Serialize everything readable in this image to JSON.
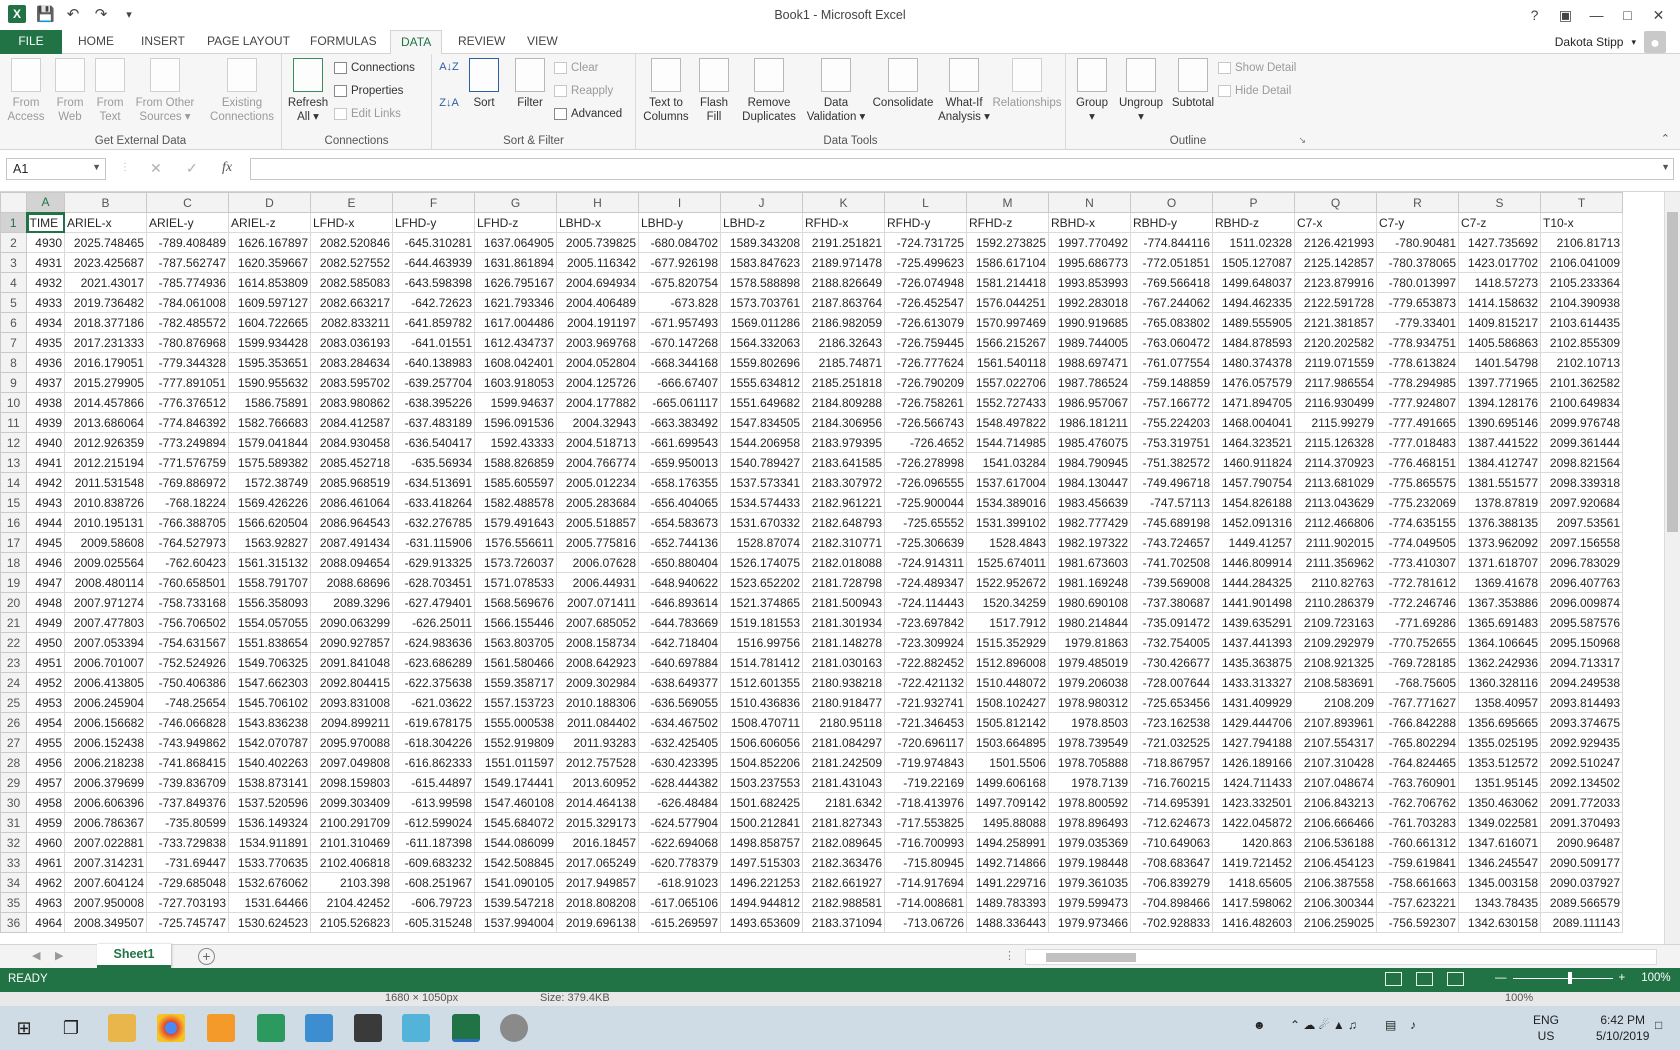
{
  "window": {
    "title": "Book1 - Microsoft Excel"
  },
  "user": {
    "name": "Dakota Stipp"
  },
  "tabs": [
    "FILE",
    "HOME",
    "INSERT",
    "PAGE LAYOUT",
    "FORMULAS",
    "DATA",
    "REVIEW",
    "VIEW"
  ],
  "ribbon": {
    "get_external": {
      "label": "Get External Data",
      "from_access": "From Access",
      "from_web": "From Web",
      "from_text": "From Text",
      "from_other": "From Other Sources",
      "existing": "Existing Connections"
    },
    "connections": {
      "label": "Connections",
      "refresh": "Refresh All",
      "connections": "Connections",
      "properties": "Properties",
      "edit_links": "Edit Links"
    },
    "sort_filter": {
      "label": "Sort & Filter",
      "sort": "Sort",
      "filter": "Filter",
      "clear": "Clear",
      "reapply": "Reapply",
      "advanced": "Advanced"
    },
    "data_tools": {
      "label": "Data Tools",
      "text_to_columns": "Text to Columns",
      "flash_fill": "Flash Fill",
      "remove_duplicates": "Remove Duplicates",
      "data_validation": "Data Validation",
      "consolidate": "Consolidate",
      "what_if": "What-If Analysis",
      "relationships": "Relationships"
    },
    "outline": {
      "label": "Outline",
      "group": "Group",
      "ungroup": "Ungroup",
      "subtotal": "Subtotal",
      "show_detail": "Show Detail",
      "hide_detail": "Hide Detail"
    }
  },
  "formula_bar": {
    "name_box": "A1",
    "fx": "fx",
    "value": ""
  },
  "grid": {
    "columns": [
      "A",
      "B",
      "C",
      "D",
      "E",
      "F",
      "G",
      "H",
      "I",
      "J",
      "K",
      "L",
      "M",
      "N",
      "O",
      "P",
      "Q",
      "R",
      "S",
      "T"
    ],
    "header_row": [
      "TIME",
      "ARIEL-x",
      "ARIEL-y",
      "ARIEL-z",
      "LFHD-x",
      "LFHD-y",
      "LFHD-z",
      "LBHD-x",
      "LBHD-y",
      "LBHD-z",
      "RFHD-x",
      "RFHD-y",
      "RFHD-z",
      "RBHD-x",
      "RBHD-y",
      "RBHD-z",
      "C7-x",
      "C7-y",
      "C7-z",
      "T10-x"
    ],
    "rows": [
      [
        "4930",
        "2025.748465",
        "-789.408489",
        "1626.167897",
        "2082.520846",
        "-645.310281",
        "1637.064905",
        "2005.739825",
        "-680.084702",
        "1589.343208",
        "2191.251821",
        "-724.731725",
        "1592.273825",
        "1997.770492",
        "-774.844116",
        "1511.02328",
        "2126.421993",
        "-780.90481",
        "1427.735692",
        "2106.81713"
      ],
      [
        "4931",
        "2023.425687",
        "-787.562747",
        "1620.359667",
        "2082.527552",
        "-644.463939",
        "1631.861894",
        "2005.116342",
        "-677.926198",
        "1583.847623",
        "2189.971478",
        "-725.499623",
        "1586.617104",
        "1995.686773",
        "-772.051851",
        "1505.127087",
        "2125.142857",
        "-780.378065",
        "1423.017702",
        "2106.041009"
      ],
      [
        "4932",
        "2021.43017",
        "-785.774936",
        "1614.853809",
        "2082.585083",
        "-643.598398",
        "1626.795167",
        "2004.694934",
        "-675.820754",
        "1578.588898",
        "2188.826649",
        "-726.074948",
        "1581.214418",
        "1993.853993",
        "-769.566418",
        "1499.648037",
        "2123.879916",
        "-780.013997",
        "1418.57273",
        "2105.233364"
      ],
      [
        "4933",
        "2019.736482",
        "-784.061008",
        "1609.597127",
        "2082.663217",
        "-642.72623",
        "1621.793346",
        "2004.406489",
        "-673.828",
        "1573.703761",
        "2187.863764",
        "-726.452547",
        "1576.044251",
        "1992.283018",
        "-767.244062",
        "1494.462335",
        "2122.591728",
        "-779.653873",
        "1414.158632",
        "2104.390938"
      ],
      [
        "4934",
        "2018.377186",
        "-782.485572",
        "1604.722665",
        "2082.833211",
        "-641.859782",
        "1617.004486",
        "2004.191197",
        "-671.957493",
        "1569.011286",
        "2186.982059",
        "-726.613079",
        "1570.997469",
        "1990.919685",
        "-765.083802",
        "1489.555905",
        "2121.381857",
        "-779.33401",
        "1409.815217",
        "2103.614435"
      ],
      [
        "4935",
        "2017.231333",
        "-780.876968",
        "1599.934428",
        "2083.036193",
        "-641.01551",
        "1612.434737",
        "2003.969768",
        "-670.147268",
        "1564.332063",
        "2186.32643",
        "-726.759445",
        "1566.215267",
        "1989.744005",
        "-763.060472",
        "1484.878593",
        "2120.202582",
        "-778.934751",
        "1405.586863",
        "2102.855309"
      ],
      [
        "4936",
        "2016.179051",
        "-779.344328",
        "1595.353651",
        "2083.284634",
        "-640.138983",
        "1608.042401",
        "2004.052804",
        "-668.344168",
        "1559.802696",
        "2185.74871",
        "-726.777624",
        "1561.540118",
        "1988.697471",
        "-761.077554",
        "1480.374378",
        "2119.071559",
        "-778.613824",
        "1401.54798",
        "2102.10713"
      ],
      [
        "4937",
        "2015.279905",
        "-777.891051",
        "1590.955632",
        "2083.595702",
        "-639.257704",
        "1603.918053",
        "2004.125726",
        "-666.67407",
        "1555.634812",
        "2185.251818",
        "-726.790209",
        "1557.022706",
        "1987.786524",
        "-759.148859",
        "1476.057579",
        "2117.986554",
        "-778.294985",
        "1397.771965",
        "2101.362582"
      ],
      [
        "4938",
        "2014.457866",
        "-776.376512",
        "1586.75891",
        "2083.980862",
        "-638.395226",
        "1599.94637",
        "2004.177882",
        "-665.061117",
        "1551.649682",
        "2184.809288",
        "-726.758261",
        "1552.727433",
        "1986.957067",
        "-757.166772",
        "1471.894705",
        "2116.930499",
        "-777.924807",
        "1394.128176",
        "2100.649834"
      ],
      [
        "4939",
        "2013.686064",
        "-774.846392",
        "1582.766683",
        "2084.412587",
        "-637.483189",
        "1596.091536",
        "2004.32943",
        "-663.383492",
        "1547.834505",
        "2184.306956",
        "-726.566743",
        "1548.497822",
        "1986.181211",
        "-755.224203",
        "1468.004041",
        "2115.99279",
        "-777.491665",
        "1390.695146",
        "2099.976748"
      ],
      [
        "4940",
        "2012.926359",
        "-773.249894",
        "1579.041844",
        "2084.930458",
        "-636.540417",
        "1592.43333",
        "2004.518713",
        "-661.699543",
        "1544.206958",
        "2183.979395",
        "-726.4652",
        "1544.714985",
        "1985.476075",
        "-753.319751",
        "1464.323521",
        "2115.126328",
        "-777.018483",
        "1387.441522",
        "2099.361444"
      ],
      [
        "4941",
        "2012.215194",
        "-771.576759",
        "1575.589382",
        "2085.452718",
        "-635.56934",
        "1588.826859",
        "2004.766774",
        "-659.950013",
        "1540.789427",
        "2183.641585",
        "-726.278998",
        "1541.03284",
        "1984.790945",
        "-751.382572",
        "1460.911824",
        "2114.370923",
        "-776.468151",
        "1384.412747",
        "2098.821564"
      ],
      [
        "4942",
        "2011.531548",
        "-769.886972",
        "1572.38749",
        "2085.968519",
        "-634.513691",
        "1585.605597",
        "2005.012234",
        "-658.176355",
        "1537.573341",
        "2183.307972",
        "-726.096555",
        "1537.617004",
        "1984.130447",
        "-749.496718",
        "1457.790754",
        "2113.681029",
        "-775.865575",
        "1381.551577",
        "2098.339318"
      ],
      [
        "4943",
        "2010.838726",
        "-768.18224",
        "1569.426226",
        "2086.461064",
        "-633.418264",
        "1582.488578",
        "2005.283684",
        "-656.404065",
        "1534.574433",
        "2182.961221",
        "-725.900044",
        "1534.389016",
        "1983.456639",
        "-747.57113",
        "1454.826188",
        "2113.043629",
        "-775.232069",
        "1378.87819",
        "2097.920684"
      ],
      [
        "4944",
        "2010.195131",
        "-766.388705",
        "1566.620504",
        "2086.964543",
        "-632.276785",
        "1579.491643",
        "2005.518857",
        "-654.583673",
        "1531.670332",
        "2182.648793",
        "-725.65552",
        "1531.399102",
        "1982.777429",
        "-745.689198",
        "1452.091316",
        "2112.466806",
        "-774.635155",
        "1376.388135",
        "2097.53561"
      ],
      [
        "4945",
        "2009.58608",
        "-764.527973",
        "1563.92827",
        "2087.491434",
        "-631.115906",
        "1576.556611",
        "2005.775816",
        "-652.744136",
        "1528.87074",
        "2182.310771",
        "-725.306639",
        "1528.4843",
        "1982.197322",
        "-743.724657",
        "1449.41257",
        "2111.902015",
        "-774.049505",
        "1373.962092",
        "2097.156558"
      ],
      [
        "4946",
        "2009.025564",
        "-762.60423",
        "1561.315132",
        "2088.094654",
        "-629.913325",
        "1573.726037",
        "2006.07628",
        "-650.880404",
        "1526.174075",
        "2182.018088",
        "-724.914311",
        "1525.674011",
        "1981.673603",
        "-741.702508",
        "1446.809914",
        "2111.356962",
        "-773.410307",
        "1371.618707",
        "2096.783029"
      ],
      [
        "4947",
        "2008.480114",
        "-760.658501",
        "1558.791707",
        "2088.68696",
        "-628.703451",
        "1571.078533",
        "2006.44931",
        "-648.940622",
        "1523.652202",
        "2181.728798",
        "-724.489347",
        "1522.952672",
        "1981.169248",
        "-739.569008",
        "1444.284325",
        "2110.82763",
        "-772.781612",
        "1369.41678",
        "2096.407763"
      ],
      [
        "4948",
        "2007.971274",
        "-758.733168",
        "1556.358093",
        "2089.3296",
        "-627.479401",
        "1568.569676",
        "2007.071411",
        "-646.893614",
        "1521.374865",
        "2181.500943",
        "-724.114443",
        "1520.34259",
        "1980.690108",
        "-737.380687",
        "1441.901498",
        "2110.286379",
        "-772.246746",
        "1367.353886",
        "2096.009874"
      ],
      [
        "4949",
        "2007.477803",
        "-756.706502",
        "1554.057055",
        "2090.063299",
        "-626.25011",
        "1566.155446",
        "2007.685052",
        "-644.783669",
        "1519.181553",
        "2181.301934",
        "-723.697842",
        "1517.7912",
        "1980.214844",
        "-735.091472",
        "1439.635291",
        "2109.723163",
        "-771.69286",
        "1365.691483",
        "2095.587576"
      ],
      [
        "4950",
        "2007.053394",
        "-754.631567",
        "1551.838654",
        "2090.927857",
        "-624.983636",
        "1563.803705",
        "2008.158734",
        "-642.718404",
        "1516.99756",
        "2181.148278",
        "-723.309924",
        "1515.352929",
        "1979.81863",
        "-732.754005",
        "1437.441393",
        "2109.292979",
        "-770.752655",
        "1364.106645",
        "2095.150968"
      ],
      [
        "4951",
        "2006.701007",
        "-752.524926",
        "1549.706325",
        "2091.841048",
        "-623.686289",
        "1561.580466",
        "2008.642923",
        "-640.697884",
        "1514.781412",
        "2181.030163",
        "-722.882452",
        "1512.896008",
        "1979.485019",
        "-730.426677",
        "1435.363875",
        "2108.921325",
        "-769.728185",
        "1362.242936",
        "2094.713317"
      ],
      [
        "4952",
        "2006.413805",
        "-750.406386",
        "1547.662303",
        "2092.804415",
        "-622.375638",
        "1559.358717",
        "2009.302984",
        "-638.649377",
        "1512.601355",
        "2180.938218",
        "-722.421132",
        "1510.448072",
        "1979.206038",
        "-728.007644",
        "1433.313327",
        "2108.583691",
        "-768.75605",
        "1360.328116",
        "2094.249538"
      ],
      [
        "4953",
        "2006.245904",
        "-748.25654",
        "1545.706102",
        "2093.831008",
        "-621.03622",
        "1557.153723",
        "2010.188306",
        "-636.569055",
        "1510.436836",
        "2180.918477",
        "-721.932741",
        "1508.102427",
        "1978.980312",
        "-725.653456",
        "1431.409929",
        "2108.209",
        "-767.771627",
        "1358.40957",
        "2093.814493"
      ],
      [
        "4954",
        "2006.156682",
        "-746.066828",
        "1543.836238",
        "2094.899211",
        "-619.678175",
        "1555.000538",
        "2011.084402",
        "-634.467502",
        "1508.470711",
        "2180.95118",
        "-721.346453",
        "1505.812142",
        "1978.8503",
        "-723.162538",
        "1429.444706",
        "2107.893961",
        "-766.842288",
        "1356.695665",
        "2093.374675"
      ],
      [
        "4955",
        "2006.152438",
        "-743.949862",
        "1542.070787",
        "2095.970088",
        "-618.304226",
        "1552.919809",
        "2011.93283",
        "-632.425405",
        "1506.606056",
        "2181.084297",
        "-720.696117",
        "1503.664895",
        "1978.739549",
        "-721.032525",
        "1427.794188",
        "2107.554317",
        "-765.802294",
        "1355.025195",
        "2092.929435"
      ],
      [
        "4956",
        "2006.218238",
        "-741.868415",
        "1540.402263",
        "2097.049808",
        "-616.862333",
        "1551.011597",
        "2012.757528",
        "-630.423395",
        "1504.852206",
        "2181.242509",
        "-719.974843",
        "1501.5506",
        "1978.705888",
        "-718.867957",
        "1426.189166",
        "2107.310428",
        "-764.824465",
        "1353.512572",
        "2092.510247"
      ],
      [
        "4957",
        "2006.379699",
        "-739.836709",
        "1538.873141",
        "2098.159803",
        "-615.44897",
        "1549.174441",
        "2013.60952",
        "-628.444382",
        "1503.237553",
        "2181.431043",
        "-719.22169",
        "1499.606168",
        "1978.7139",
        "-716.760215",
        "1424.711433",
        "2107.048674",
        "-763.760901",
        "1351.95145",
        "2092.134502"
      ],
      [
        "4958",
        "2006.606396",
        "-737.849376",
        "1537.520596",
        "2099.303409",
        "-613.99598",
        "1547.460108",
        "2014.464138",
        "-626.48484",
        "1501.682425",
        "2181.6342",
        "-718.413976",
        "1497.709142",
        "1978.800592",
        "-714.695391",
        "1423.332501",
        "2106.843213",
        "-762.706762",
        "1350.463062",
        "2091.772033"
      ],
      [
        "4959",
        "2006.786367",
        "-735.80599",
        "1536.149324",
        "2100.291709",
        "-612.599024",
        "1545.684072",
        "2015.329173",
        "-624.577904",
        "1500.212841",
        "2181.827343",
        "-717.553825",
        "1495.88088",
        "1978.896493",
        "-712.624673",
        "1422.045872",
        "2106.666466",
        "-761.703283",
        "1349.022581",
        "2091.370493"
      ],
      [
        "4960",
        "2007.022881",
        "-733.729838",
        "1534.911891",
        "2101.310469",
        "-611.187398",
        "1544.086099",
        "2016.18457",
        "-622.694068",
        "1498.858757",
        "2182.089645",
        "-716.700993",
        "1494.258991",
        "1979.035369",
        "-710.649063",
        "1420.863",
        "2106.536188",
        "-760.661312",
        "1347.616071",
        "2090.96487"
      ],
      [
        "4961",
        "2007.314231",
        "-731.69447",
        "1533.770635",
        "2102.406818",
        "-609.683232",
        "1542.508845",
        "2017.065249",
        "-620.778379",
        "1497.515303",
        "2182.363476",
        "-715.80945",
        "1492.714866",
        "1979.198448",
        "-708.683647",
        "1419.721452",
        "2106.454123",
        "-759.619841",
        "1346.245547",
        "2090.509177"
      ],
      [
        "4962",
        "2007.604124",
        "-729.685048",
        "1532.676062",
        "2103.398",
        "-608.251967",
        "1541.090105",
        "2017.949857",
        "-618.91023",
        "1496.221253",
        "2182.661927",
        "-714.917694",
        "1491.229716",
        "1979.361035",
        "-706.839279",
        "1418.65605",
        "2106.387558",
        "-758.661663",
        "1345.003158",
        "2090.037927"
      ],
      [
        "4963",
        "2007.950008",
        "-727.703193",
        "1531.64466",
        "2104.42452",
        "-606.79723",
        "1539.547218",
        "2018.808208",
        "-617.065106",
        "1494.944812",
        "2182.988581",
        "-714.008681",
        "1489.783393",
        "1979.599473",
        "-704.898466",
        "1417.598062",
        "2106.300344",
        "-757.623221",
        "1343.78435",
        "2089.566579"
      ],
      [
        "4964",
        "2008.349507",
        "-725.745747",
        "1530.624523",
        "2105.526823",
        "-605.315248",
        "1537.994004",
        "2019.696138",
        "-615.269597",
        "1493.653609",
        "2183.371094",
        "-713.06726",
        "1488.336443",
        "1979.973466",
        "-702.928833",
        "1416.482603",
        "2106.259025",
        "-756.592307",
        "1342.630158",
        "2089.111143"
      ]
    ]
  },
  "sheet": {
    "tab": "Sheet1"
  },
  "status": {
    "ready": "READY",
    "zoom": "100%"
  },
  "ghost_bar": {
    "dims": "1680 × 1050px",
    "size": "Size: 379.4KB",
    "zoom": "100%"
  },
  "taskbar": {
    "lang": "ENG",
    "locale": "US",
    "time": "6:42 PM",
    "date": "5/10/2019"
  },
  "colors": {
    "excel_green": "#217346"
  }
}
